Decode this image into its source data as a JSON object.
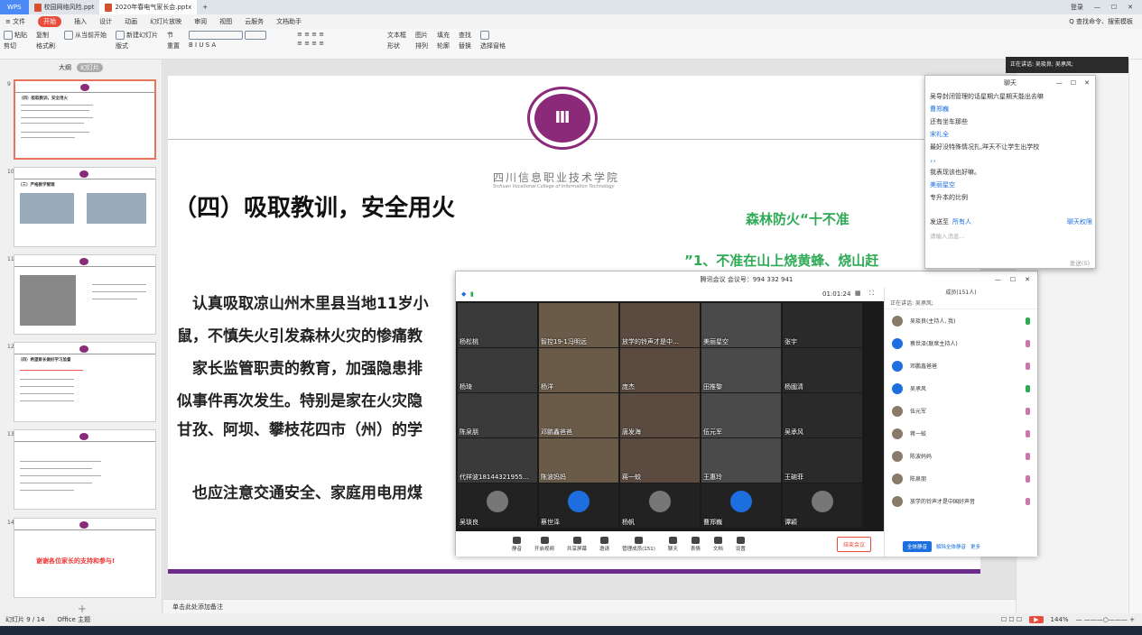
{
  "titlebar": {
    "app": "WPS",
    "tabs": [
      "校园网络风险.ppt",
      "2020年春电气家长会.pptx"
    ],
    "new_tab": "+",
    "login": "登录"
  },
  "menubar": {
    "file": "≡ 文件",
    "start": "开始",
    "items": [
      "插入",
      "设计",
      "动画",
      "幻灯片放映",
      "审阅",
      "视图",
      "云服务",
      "文档助手"
    ],
    "search": "Q 查找命令、搜索模板"
  },
  "ribbon": {
    "groups": [
      [
        "粘贴",
        "剪切",
        "复制",
        "格式刷"
      ],
      [
        "从当前开始"
      ],
      [
        "新建幻灯片",
        "版式",
        "节"
      ],
      [
        "重置"
      ],
      [
        "文本框",
        "形状",
        "排列"
      ],
      [
        "图片",
        "填充",
        "轮廓"
      ],
      [
        "查找",
        "替换"
      ],
      [
        "选择窗格"
      ]
    ]
  },
  "leftpanel": {
    "tabs": [
      "大纲",
      "幻灯片"
    ],
    "slides": [
      {
        "num": "9",
        "title": "（四）吸取教训，安全用火"
      },
      {
        "num": "10",
        "title": "（三）严格教学管理"
      },
      {
        "num": "11",
        "title": ""
      },
      {
        "num": "12",
        "title": "（四）希望家长做好学习监督"
      },
      {
        "num": "13",
        "title": ""
      },
      {
        "num": "14",
        "title": "谢谢各位家长的支持和参与!"
      }
    ],
    "add": "+"
  },
  "slide": {
    "school_cn": "四川信息职业技术学院",
    "school_en": "Sichuan Vocational College of Information Technology",
    "title": "（四）吸取教训，安全用火",
    "green1": "森林防火“十不准",
    "green2": "”1、不准在山上烧黄蜂、烧山赶",
    "lines": [
      "　认真吸取凉山州木里县当地11岁小",
      "鼠，不慎失火引发森林火灾的惨痛教",
      "　家长监管职责的教育，加强隐患排",
      "似事件再次发生。特别是家在火灾隐",
      "甘孜、阿坝、攀枝花四市（州）的学",
      "　也应注意交通安全、家庭用电用煤"
    ]
  },
  "notes": "单击此处添加备注",
  "statusbar": {
    "slide_count": "幻灯片 9 / 14",
    "theme": "Office 主题",
    "zoom": "144%"
  },
  "meeting": {
    "title": "腾讯会议 会议号：994 332 941",
    "timer": "01:01:24",
    "tiles": [
      "杨松桃",
      "智控19-1冯明远",
      "放学的铃声才是中…",
      "美丽星空",
      "张宇",
      "杨琦",
      "杨洋",
      "庞杰",
      "田推黎",
      "杨國清",
      "陈泉朋",
      "邓鹏鑫爸爸",
      "唐发海",
      "伍元军",
      "吴承风",
      "代祥波18144321955…",
      "陈波妈妈",
      "蒋一蛟",
      "王惠玲",
      "王碗菲",
      "吴琰良",
      "蔡世泽",
      "杨帆",
      "曹郑巍",
      "谭颖"
    ],
    "host_tag": "主持人",
    "cohost_tag": "联席主持人",
    "toolbar": [
      "静音",
      "开启视频",
      "共享屏幕",
      "邀请",
      "管理成员(151)",
      "聊天",
      "表情",
      "文档",
      "设置"
    ],
    "end": "结束会议",
    "members_title": "成员(151人)",
    "speaking": "正在讲话: 吴承风;",
    "members": [
      "吴琰良(主持人, 我)",
      "蔡世泽(联席主持人)",
      "邓鹏鑫爸爸",
      "吴承风",
      "伍元军",
      "蒋一蛟",
      "陈波妈妈",
      "陈泉朋",
      "放学的铃声才是中国好声音"
    ],
    "foot": [
      "全体静音",
      "解除全体静音",
      "更多"
    ]
  },
  "chat": {
    "title": "聊天",
    "messages": [
      {
        "user": "",
        "text": "吴导封闭管理的话星期六星期天能出去嘛"
      },
      {
        "user": "曹郑巍",
        "text": "还有坐车那些"
      },
      {
        "user": "宋礼全",
        "text": "最好没特殊情况扎,咩天不让学生出学校"
      },
      {
        "user": "，，",
        "text": "我表现该也好嘛。"
      },
      {
        "user": "美丽星空",
        "text": "专升本的比例"
      }
    ],
    "send_to": "发送至",
    "all": "所有人",
    "perm": "聊天权限",
    "placeholder": "请输入消息...",
    "send": "发送(S)"
  },
  "speaker_banner": "正在讲话: 吴琰良; 吴承风;"
}
